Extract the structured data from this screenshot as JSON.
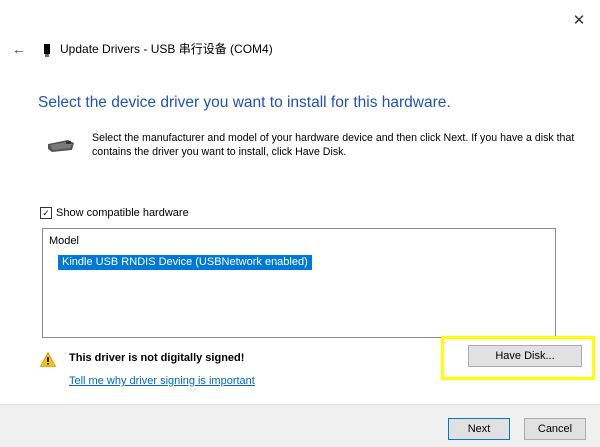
{
  "window": {
    "close_glyph": "✕",
    "back_glyph": "←",
    "title": "Update Drivers - USB 串行设备 (COM4)"
  },
  "main": {
    "heading": "Select the device driver you want to install for this hardware.",
    "description": "Select the manufacturer and model of your hardware device and then click Next. If you have a disk that contains the driver you want to install, click Have Disk.",
    "icons": {
      "back": "back-arrow-icon",
      "device": "usb-device-icon",
      "hardware": "hardware-driver-icon",
      "warning": "warning-icon"
    }
  },
  "compatible": {
    "label": "Show compatible hardware",
    "checked": true,
    "check_glyph": "✓"
  },
  "model_list": {
    "header": "Model",
    "items": [
      {
        "label": "Kindle USB RNDIS Device (USBNetwork enabled)",
        "selected": true
      }
    ]
  },
  "warning": {
    "text": "This driver is not digitally signed!",
    "link": "Tell me why driver signing is important"
  },
  "buttons": {
    "have_disk": "Have Disk...",
    "next": "Next",
    "cancel": "Cancel"
  },
  "colors": {
    "heading": "#1f52b8",
    "selection": "#0078d7",
    "highlight": "#ffff00",
    "link": "#0066cc",
    "warning": "#f5c211"
  }
}
